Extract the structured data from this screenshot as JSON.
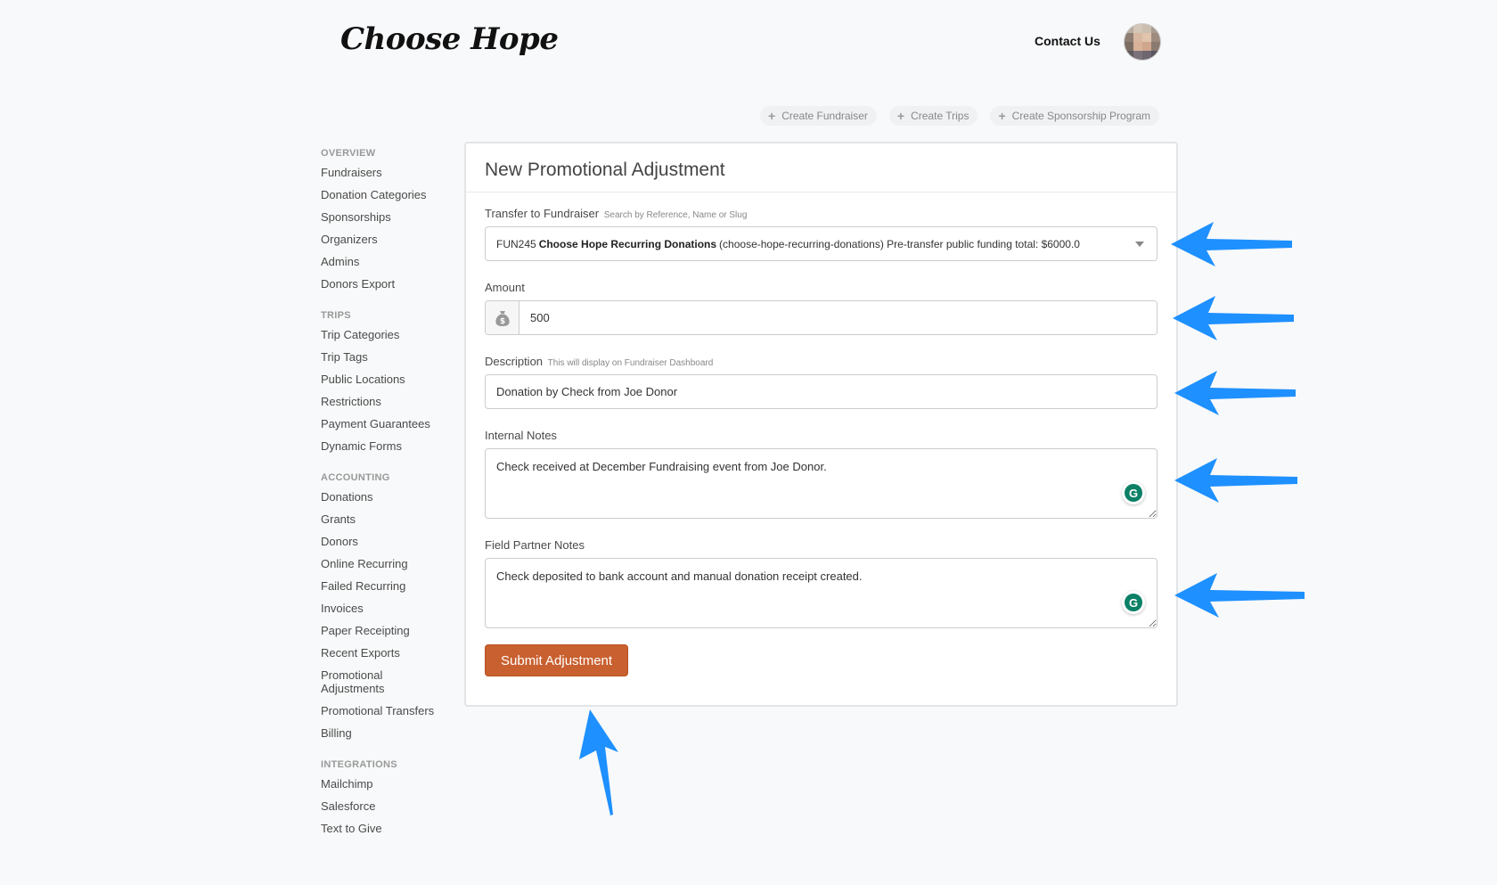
{
  "header": {
    "logo": "Choose Hope",
    "contact_label": "Contact Us"
  },
  "create_buttons": [
    {
      "label": "Create Fundraiser"
    },
    {
      "label": "Create Trips"
    },
    {
      "label": "Create Sponsorship Program"
    }
  ],
  "sidebar": {
    "sections": [
      {
        "heading": "OVERVIEW",
        "items": [
          "Fundraisers",
          "Donation Categories",
          "Sponsorships",
          "Organizers",
          "Admins",
          "Donors Export"
        ]
      },
      {
        "heading": "TRIPS",
        "items": [
          "Trip Categories",
          "Trip Tags",
          "Public Locations",
          "Restrictions",
          "Payment Guarantees",
          "Dynamic Forms"
        ]
      },
      {
        "heading": "ACCOUNTING",
        "items": [
          "Donations",
          "Grants",
          "Donors",
          "Online Recurring",
          "Failed Recurring",
          "Invoices",
          "Paper Receipting",
          "Recent Exports",
          "Promotional Adjustments",
          "Promotional Transfers",
          "Billing"
        ]
      },
      {
        "heading": "INTEGRATIONS",
        "items": [
          "Mailchimp",
          "Salesforce",
          "Text to Give"
        ]
      }
    ]
  },
  "form": {
    "title": "New Promotional Adjustment",
    "transfer": {
      "label": "Transfer to Fundraiser",
      "hint": "Search by Reference, Name or Slug",
      "ref": "FUN245",
      "name": "Choose Hope Recurring Donations",
      "rest": "(choose-hope-recurring-donations) Pre-transfer public funding total: $6000.0"
    },
    "amount": {
      "label": "Amount",
      "value": "500"
    },
    "description": {
      "label": "Description",
      "hint": "This will display on Fundraiser Dashboard",
      "value": "Donation by Check from Joe Donor"
    },
    "internal_notes": {
      "label": "Internal Notes",
      "value": "Check received at December Fundraising event from Joe Donor."
    },
    "field_partner_notes": {
      "label": "Field Partner Notes",
      "value": "Check deposited to bank account and manual donation receipt created."
    },
    "submit_label": "Submit Adjustment",
    "grammarly_glyph": "G"
  },
  "colors": {
    "accent": "#c9602f",
    "arrow": "#1e90ff",
    "grammarly": "#0b8066"
  }
}
